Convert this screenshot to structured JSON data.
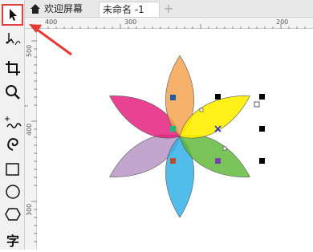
{
  "tabs": {
    "welcome_label": "欢迎屏幕",
    "document_label": "未命名 -1",
    "add_label": "+"
  },
  "ruler": {
    "horizontal_labels": [
      "400",
      "300",
      "200"
    ],
    "vertical_labels": [
      "500",
      "400",
      "300"
    ]
  },
  "toolbox": {
    "text_tool_label": "字"
  },
  "colors": {
    "petal_orange": "#f4a04a",
    "petal_yellow": "#ffee00",
    "petal_green": "#5ab531",
    "petal_blue": "#33b2e8",
    "petal_purple": "#b28dc0",
    "petal_magenta": "#e5197a",
    "annotation_red": "#e53935"
  }
}
